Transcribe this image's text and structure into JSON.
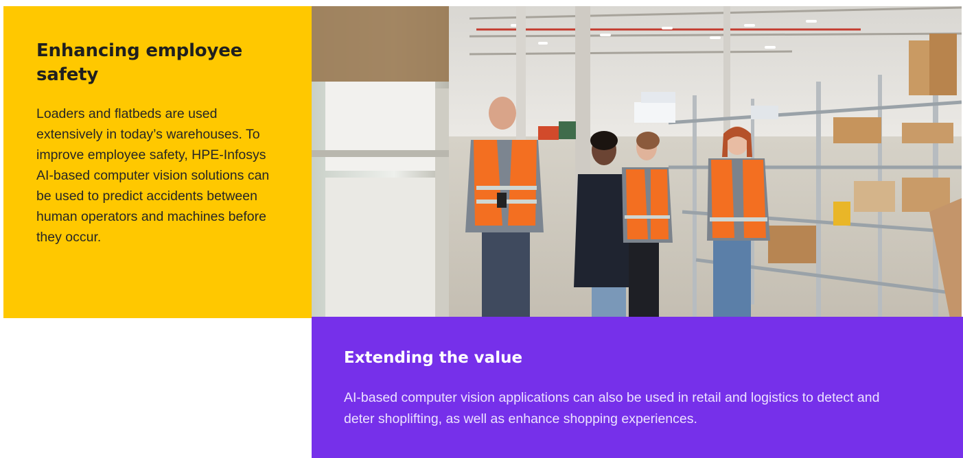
{
  "safety_card": {
    "title": "Enhancing employee safety",
    "body": "Loaders and flatbeds are used extensively in today’s warehouses. To improve employee safety, HPE-Infosys AI-based computer vision solutions can be used to predict accidents between human operators and machines before they occur.",
    "background_color": "#ffc800"
  },
  "value_card": {
    "title": "Extending the value",
    "body": "AI-based computer vision applications can also be used in retail and logistics to detect and deter shoplifting, as well as enhance shopping experiences.",
    "background_color": "#7630ea"
  },
  "photo": {
    "icon": "warehouse-workers-photo"
  }
}
